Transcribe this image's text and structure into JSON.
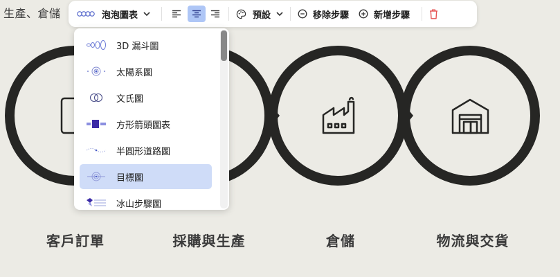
{
  "page_title": "生產、倉儲",
  "toolbar": {
    "type_label": "泡泡圖表",
    "style_label": "預設",
    "remove_step_label": "移除步驟",
    "add_step_label": "新增步驟"
  },
  "dropdown": {
    "items": [
      {
        "label": "3D 漏斗圖"
      },
      {
        "label": "太陽系圖"
      },
      {
        "label": "文氏圖"
      },
      {
        "label": "方形箭頭圖表"
      },
      {
        "label": "半圓形道路圖"
      },
      {
        "label": "目標圖",
        "selected": true
      },
      {
        "label": "冰山步驟圖"
      }
    ]
  },
  "diagram": {
    "steps": [
      {
        "label": "客戶訂單",
        "icon": "checklist-icon"
      },
      {
        "label": "採購與生產",
        "icon": "hidden"
      },
      {
        "label": "倉儲",
        "icon": "factory-icon"
      },
      {
        "label": "物流與交貨",
        "icon": "warehouse-icon"
      }
    ]
  },
  "colors": {
    "background": "#ecebe5",
    "ring": "#262624",
    "selected_item": "#cfdcf8",
    "active_align": "#aec6f6",
    "delete": "#e55353"
  }
}
